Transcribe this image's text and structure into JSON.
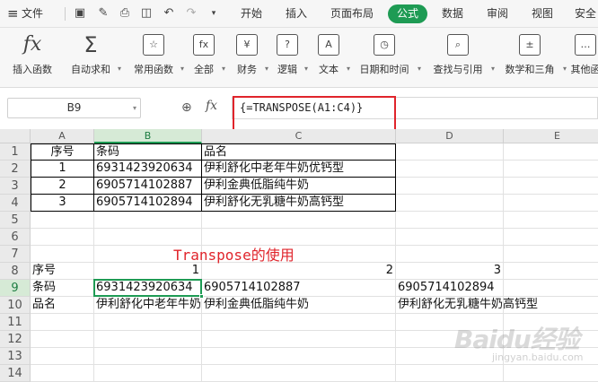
{
  "menu": {
    "file": "文件",
    "tabs": [
      "开始",
      "插入",
      "页面布局",
      "公式",
      "数据",
      "审阅",
      "视图",
      "安全"
    ],
    "active_tab": "公式"
  },
  "ribbon": {
    "buttons": [
      {
        "label": "插入函数",
        "icon": "fx-icon",
        "glyph": "fx",
        "dropdown": false
      },
      {
        "label": "自动求和",
        "icon": "sum-icon",
        "glyph": "Σ",
        "dropdown": true
      },
      {
        "label": "常用函数",
        "icon": "common-functions-icon",
        "glyph": "☆",
        "dropdown": true
      },
      {
        "label": "全部",
        "icon": "all-functions-icon",
        "glyph": "fx",
        "dropdown": true
      },
      {
        "label": "财务",
        "icon": "finance-icon",
        "glyph": "¥",
        "dropdown": true
      },
      {
        "label": "逻辑",
        "icon": "logic-icon",
        "glyph": "?",
        "dropdown": true
      },
      {
        "label": "文本",
        "icon": "text-icon",
        "glyph": "A",
        "dropdown": true
      },
      {
        "label": "日期和时间",
        "icon": "date-time-icon",
        "glyph": "◷",
        "dropdown": true
      },
      {
        "label": "查找与引用",
        "icon": "lookup-icon",
        "glyph": "⌕",
        "dropdown": true
      },
      {
        "label": "数学和三角",
        "icon": "math-icon",
        "glyph": "±",
        "dropdown": true
      },
      {
        "label": "其他函",
        "icon": "more-functions-icon",
        "glyph": "…",
        "dropdown": false
      }
    ]
  },
  "formula_bar": {
    "name_box": "B9",
    "fx_label": "fx",
    "formula": "{=TRANSPOSE(A1:C4)}"
  },
  "sheet": {
    "columns": [
      "A",
      "B",
      "C",
      "D",
      "E"
    ],
    "selected_column": "B",
    "rows": [
      "1",
      "2",
      "3",
      "4",
      "5",
      "6",
      "7",
      "8",
      "9",
      "10",
      "11",
      "12",
      "13",
      "14"
    ],
    "selected_row": "9",
    "cells": {
      "A1": "序号",
      "B1": "条码",
      "C1": "品名",
      "A2": "1",
      "B2": "6931423920634",
      "C2": "伊利舒化中老年牛奶优钙型",
      "A3": "2",
      "B3": "6905714102887",
      "C3": "伊利金典低脂纯牛奶",
      "A4": "3",
      "B4": "6905714102894",
      "C4": "伊利舒化无乳糖牛奶高钙型",
      "A8": "序号",
      "B8": "1",
      "C8": "2",
      "D8": "3",
      "A9": "条码",
      "B9": "6931423920634",
      "C9": "6905714102887",
      "D9": "6905714102894",
      "A10": "品名",
      "B10": "伊利舒化中老年牛奶优钙型",
      "C10": "伊利金典低脂纯牛奶",
      "D10": "伊利舒化无乳糖牛奶高钙型"
    },
    "annotation": "Transpose的使用"
  },
  "watermark": {
    "brand": "Baidu经验",
    "sub": "jingyan.baidu.com"
  },
  "colors": {
    "accent": "#1e9b54",
    "highlight": "#e0242b"
  }
}
